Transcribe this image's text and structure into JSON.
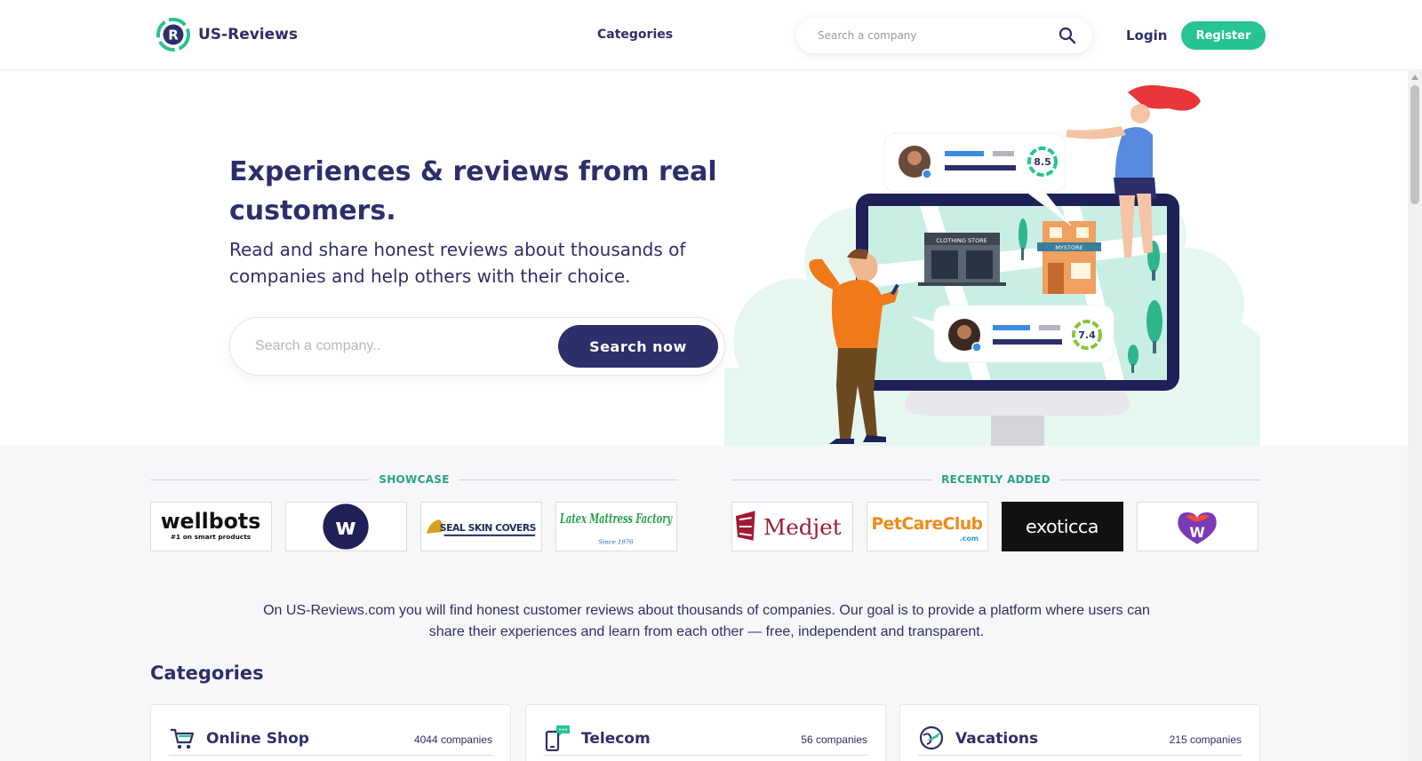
{
  "header": {
    "brand": "US-Reviews",
    "nav_categories": "Categories",
    "search_placeholder": "Search a company",
    "login": "Login",
    "register": "Register"
  },
  "hero": {
    "title": "Experiences & reviews from real customers.",
    "subtitle": "Read and share honest reviews about thousands of companies and help others with their choice.",
    "search_placeholder": "Search a company..",
    "search_button": "Search now",
    "illustration": {
      "store_sign_1": "CLOTHING STORE",
      "store_sign_2": "MYSTORE",
      "rating_1": "8.5",
      "rating_2": "7.4"
    }
  },
  "showcase": {
    "heading": "SHOWCASE",
    "logos": [
      {
        "name": "wellbots",
        "text": "wellbots",
        "tagline": "#1 on smart products"
      },
      {
        "name": "w-circle",
        "text": "w"
      },
      {
        "name": "sealskincovers",
        "text": "SEAL SKIN COVERS"
      },
      {
        "name": "latex-mattress-factory",
        "text": "Latex Mattress Factory",
        "tagline": "Since 1976"
      }
    ]
  },
  "recently_added": {
    "heading": "RECENTLY ADDED",
    "logos": [
      {
        "name": "medjet",
        "text": "Medjet"
      },
      {
        "name": "petcareclub",
        "text": "PetCareClub",
        "tagline": ".com"
      },
      {
        "name": "exoticca",
        "text": "exoticca"
      },
      {
        "name": "w-heart",
        "text": "W"
      }
    ]
  },
  "intro_text": "On US-Reviews.com you will find honest customer reviews about thousands of companies. Our goal is to provide a platform where users can share their experiences and learn from each other — free, independent and transparent.",
  "categories": {
    "heading": "Categories",
    "items": [
      {
        "name": "Online Shop",
        "count": "4044 companies",
        "icon": "shopping-cart-icon"
      },
      {
        "name": "Telecom",
        "count": "56 companies",
        "icon": "phone-chat-icon"
      },
      {
        "name": "Vacations",
        "count": "215 companies",
        "icon": "globe-plane-icon"
      }
    ]
  },
  "colors": {
    "brand_navy": "#2d2f6b",
    "brand_green": "#27c393"
  }
}
